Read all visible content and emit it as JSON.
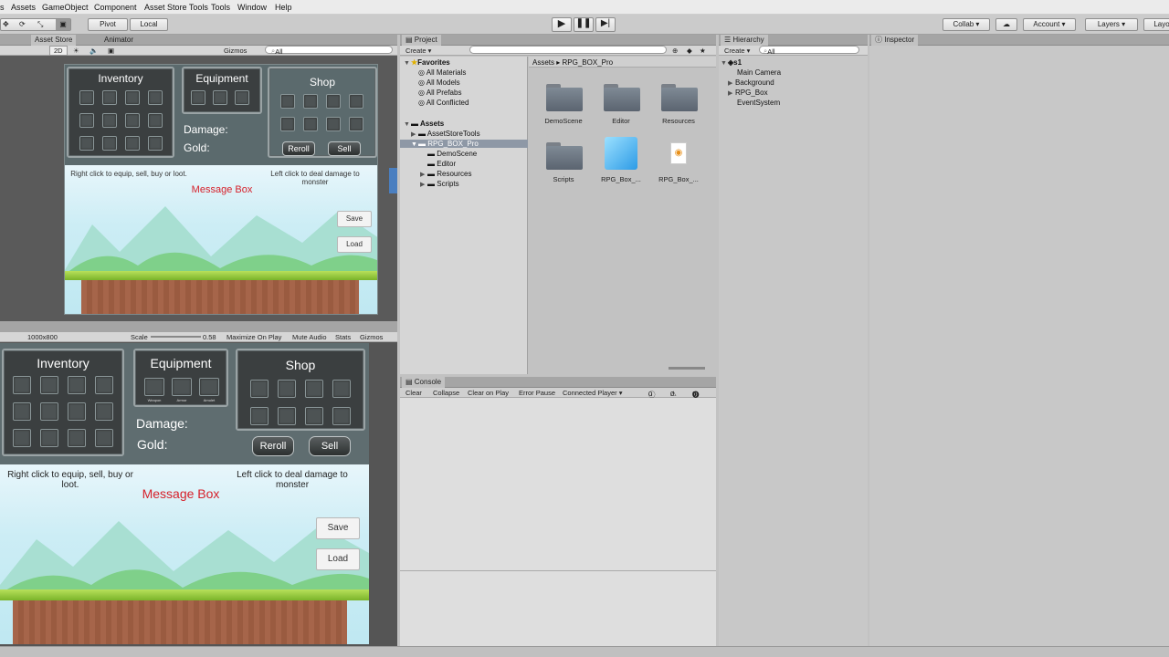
{
  "menu": [
    "Assets",
    "GameObject",
    "Component",
    "Asset Store Tools",
    "Tools",
    "Window",
    "Help"
  ],
  "toolbar": {
    "pivot": "Pivot",
    "local": "Local",
    "collab": "Collab ▾",
    "account": "Account",
    "layers": "Layers",
    "layout": "Layo"
  },
  "scene": {
    "tabs": [
      "Asset Store",
      "Animator"
    ],
    "toggle_2d": "2D",
    "gizmos": "Gizmos",
    "search": "All"
  },
  "game": {
    "resolution": "1000x800",
    "scale_label": "Scale",
    "scale_value": "0.58",
    "maximize": "Maximize On Play",
    "mute": "Mute Audio",
    "stats": "Stats",
    "gizmos": "Gizmos"
  },
  "rpg": {
    "inventory": "Inventory",
    "equipment": "Equipment",
    "shop": "Shop",
    "damage": "Damage:",
    "gold": "Gold:",
    "reroll": "Reroll",
    "sell": "Sell",
    "hint_left": "Right click to equip, sell, buy or loot.",
    "hint_right": "Left click to deal damage to monster",
    "message": "Message Box",
    "save": "Save",
    "load": "Load",
    "equip_slots": [
      "Weapon",
      "Armor",
      "Amulet"
    ]
  },
  "project": {
    "tab": "Project",
    "create": "Create ▾",
    "favorites": "Favorites",
    "fav_items": [
      "All Materials",
      "All Models",
      "All Prefabs",
      "All Conflicted"
    ],
    "assets": "Assets",
    "asset_items": [
      "AssetStoreTools",
      "RPG_BOX_Pro"
    ],
    "sub_items": [
      "DemoScene",
      "Editor",
      "Resources",
      "Scripts"
    ],
    "breadcrumb_root": "Assets",
    "breadcrumb_child": "RPG_BOX_Pro",
    "files": [
      "DemoScene",
      "Editor",
      "Resources",
      "Scripts",
      "RPG_Box_...",
      "RPG_Box_..."
    ]
  },
  "console": {
    "tab": "Console",
    "buttons": [
      "Clear",
      "Collapse",
      "Clear on Play",
      "Error Pause",
      "Connected Player ▾"
    ],
    "counts": [
      "0",
      "0",
      "0"
    ]
  },
  "hierarchy": {
    "tab": "Hierarchy",
    "create": "Create ▾",
    "search": "All",
    "scene": "s1",
    "items": [
      "Main Camera",
      "Background",
      "RPG_Box",
      "EventSystem"
    ]
  },
  "inspector": {
    "tab": "Inspector"
  }
}
